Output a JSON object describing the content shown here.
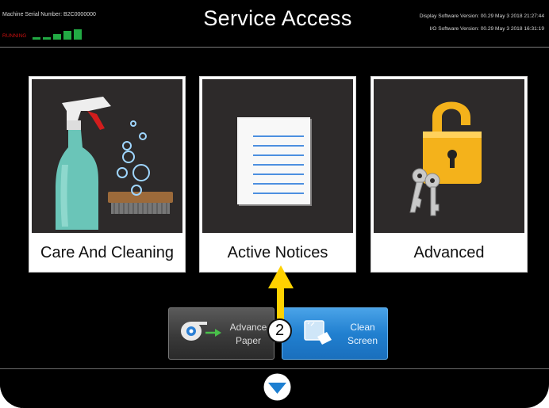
{
  "header": {
    "serial_text": "Machine Serial Number: B2C0000000",
    "status_text": "RUNNING",
    "title": "Service Access",
    "display_version": "Display Software Version: 00.29 May  3 2018 21:27:44",
    "io_version": "I/O Software Version: 00.29 May  3 2018 16:31:19"
  },
  "tiles": [
    {
      "label": "Care And Cleaning",
      "icon": "spray-bottle-brush-icon"
    },
    {
      "label": "Active Notices",
      "icon": "notice-document-icon"
    },
    {
      "label": "Advanced",
      "icon": "padlock-keys-icon"
    }
  ],
  "buttons": {
    "advance_paper": {
      "line1": "Advance",
      "line2": "Paper",
      "icon": "paper-roll-icon"
    },
    "clean_screen": {
      "line1": "Clean",
      "line2": "Screen",
      "icon": "clean-screen-icon"
    }
  },
  "annotation": {
    "callout_number": "2"
  },
  "colors": {
    "background": "#000000",
    "title_text": "#ffffff",
    "status_red": "#cc1111",
    "signal_green": "#22aa44",
    "clean_button_blue": "#2180d0",
    "arrow_yellow": "#ffd200"
  },
  "icons": {
    "scroll_down": "chevron-down-icon"
  }
}
